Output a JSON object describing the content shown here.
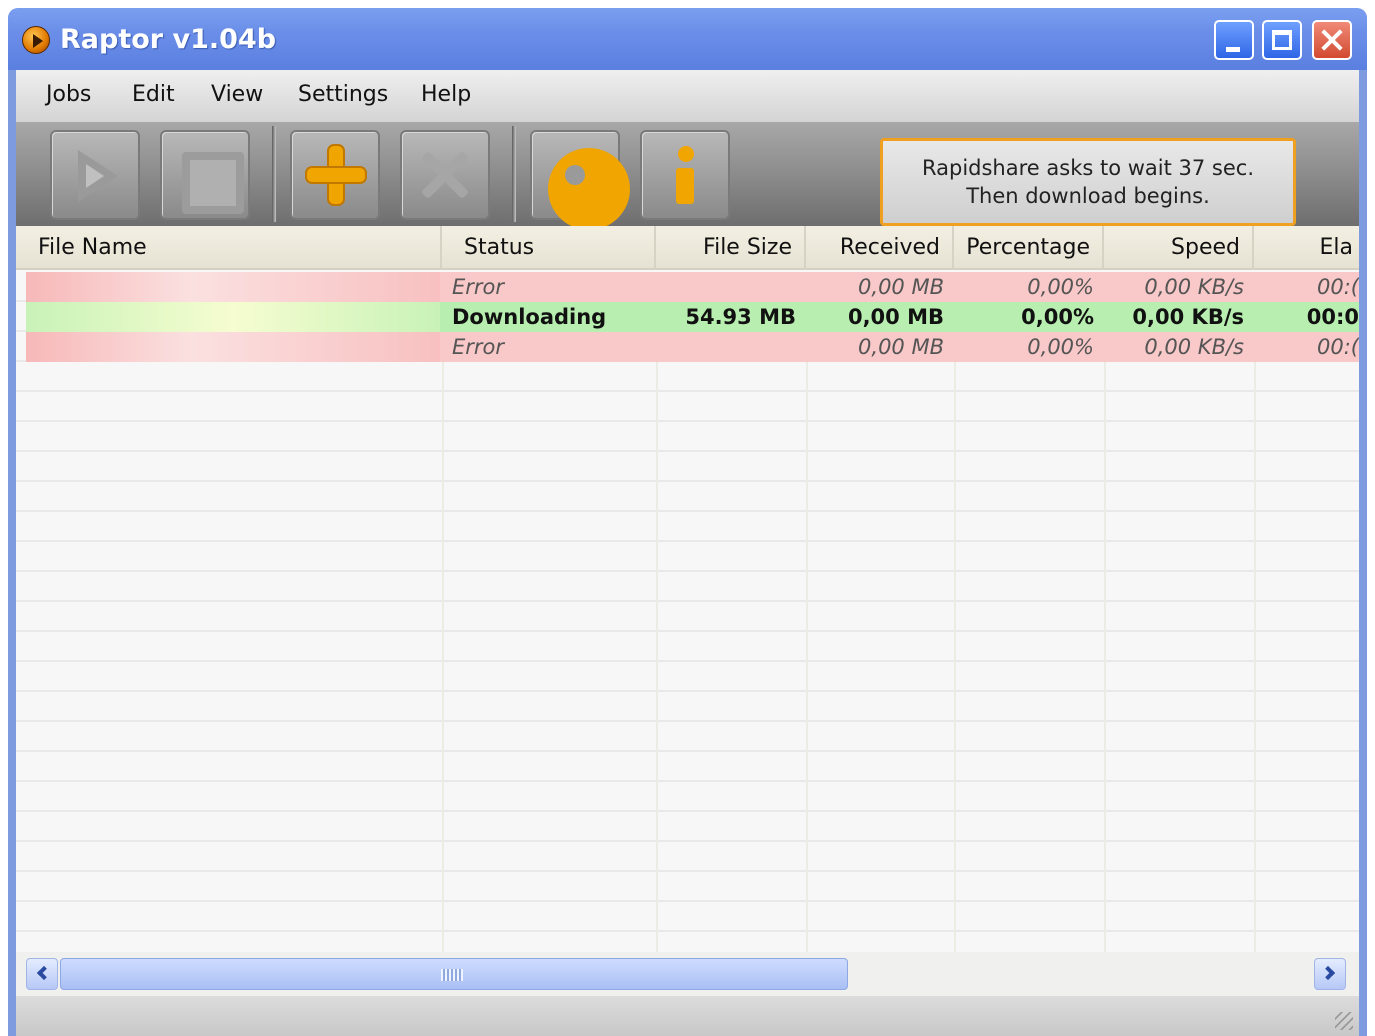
{
  "window": {
    "title": "Raptor v1.04b"
  },
  "menu": {
    "items": [
      "Jobs",
      "Edit",
      "View",
      "Settings",
      "Help"
    ]
  },
  "toolbar": {
    "buttons": [
      "play-icon",
      "stop-icon",
      "add-icon",
      "remove-icon",
      "settings-gear-icon",
      "info-icon"
    ],
    "notice": {
      "line1": "Rapidshare asks to wait 37 sec.",
      "line2": "Then download begins."
    }
  },
  "list": {
    "columns": [
      "File Name",
      "Status",
      "File Size",
      "Received",
      "Percentage",
      "Speed",
      "Ela"
    ],
    "rows": [
      {
        "filename": "",
        "status": "Error",
        "size": "",
        "received": "0,00 MB",
        "percentage": "0,00%",
        "speed": "0,00 KB/s",
        "elapsed": "00:("
      },
      {
        "filename": "",
        "status": "Downloading",
        "size": "54.93 MB",
        "received": "0,00 MB",
        "percentage": "0,00%",
        "speed": "0,00 KB/s",
        "elapsed": "00:0"
      },
      {
        "filename": "",
        "status": "Error",
        "size": "",
        "received": "0,00 MB",
        "percentage": "0,00%",
        "speed": "0,00 KB/s",
        "elapsed": "00:("
      }
    ]
  },
  "colors": {
    "error_row": "#f9c8c8",
    "downloading_row": "#b8efb0",
    "accent": "#f0a500",
    "titlebar": "#6a8ee8"
  }
}
